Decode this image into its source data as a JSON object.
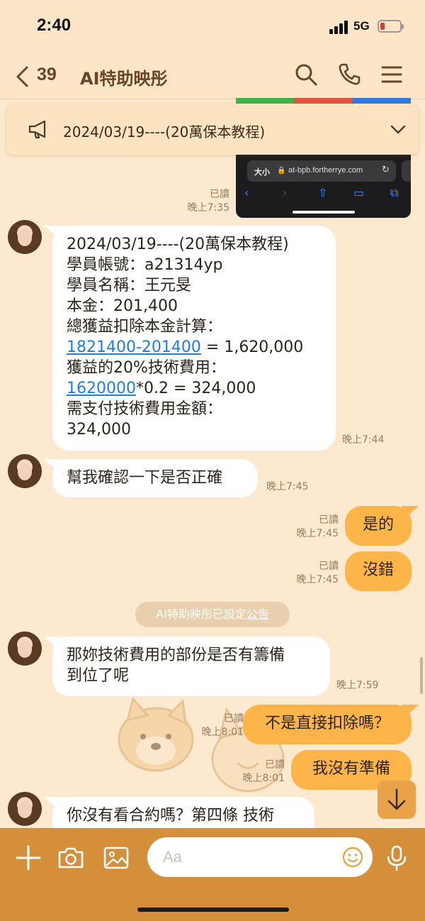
{
  "status_bar": {
    "time": "2:40",
    "network": "5G"
  },
  "header": {
    "back_count": "39",
    "title": "AI特助映彤"
  },
  "announcement": {
    "text": "2024/03/19----(20萬保本教程)"
  },
  "screenshot_preview": {
    "url": "at-bpb.fortherrye.com",
    "text_size": "大小"
  },
  "messages": {
    "m0": {
      "read": "已讀",
      "time": "晚上7:35"
    },
    "m1": {
      "line1": "2024/03/19----(20萬保本教程)",
      "line2": "學員帳號：a21314yp",
      "line3": "學員名稱：王元旻",
      "line4": "本金：201,400",
      "line5": "總獲益扣除本金計算：",
      "line6_link": "1821400-201400",
      "line6_rest": " = 1,620,000",
      "line7": "獲益的20%技術費用：",
      "line8_link": "1620000",
      "line8_rest": "*0.2 = 324,000",
      "line9": "需支付技術費用金額：",
      "line10": "324,000",
      "time": "晚上7:44"
    },
    "m2": {
      "text": "幫我確認一下是否正確",
      "time": "晚上7:45"
    },
    "m3": {
      "text": "是的",
      "read": "已讀",
      "time": "晚上7:45"
    },
    "m4": {
      "text": "沒錯",
      "read": "已讀",
      "time": "晚上7:45"
    },
    "system": {
      "prefix": "AI特助映彤已設定",
      "link": "公告"
    },
    "m5": {
      "line1": "那妳技術費用的部份是否有籌備",
      "line2": "到位了呢",
      "time": "晚上7:59"
    },
    "m6": {
      "text": "不是直接扣除嗎？",
      "read": "已讀",
      "time": "晚上8:01"
    },
    "m7": {
      "text": "我沒有準備",
      "read": "已讀",
      "time": "晚上8:01"
    },
    "m8": {
      "text": "你沒有看合約嗎？第四條  技術"
    }
  },
  "input": {
    "placeholder": "Aa"
  },
  "colors": {
    "background": "#fde9cf",
    "outgoing_bubble": "#fdb54a",
    "input_bar": "#d58e3a",
    "link": "#1e7fe0"
  }
}
